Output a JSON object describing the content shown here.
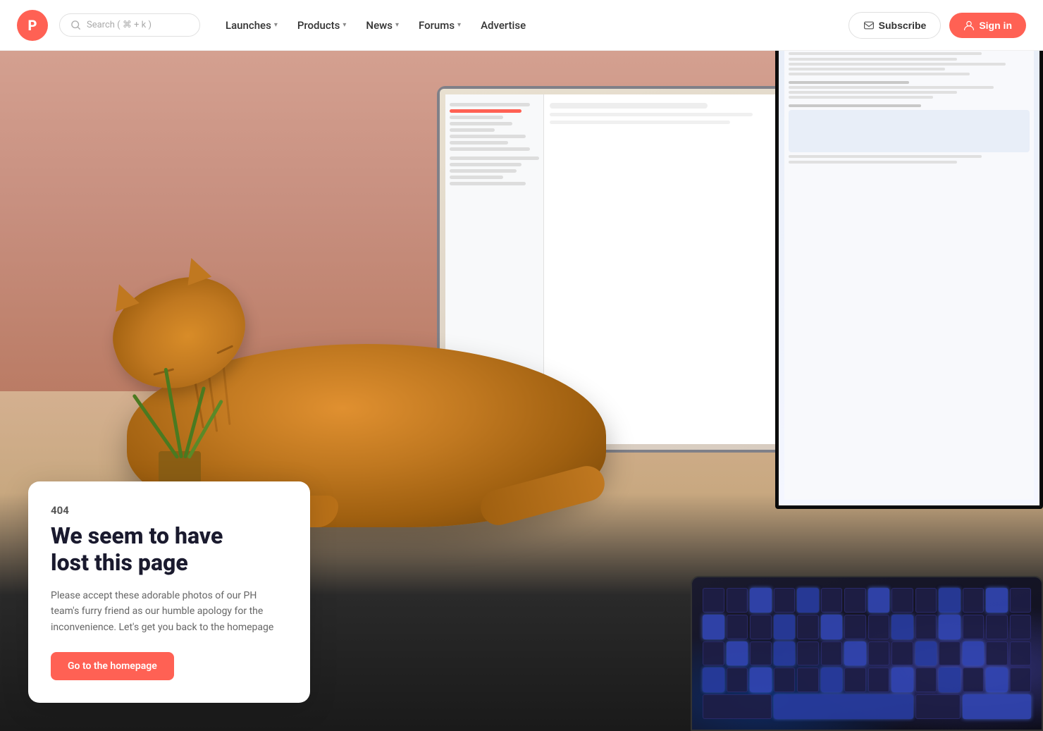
{
  "nav": {
    "logo_letter": "P",
    "search_placeholder": "Search ( ⌘ + k )",
    "links": [
      {
        "label": "Launches",
        "has_dropdown": true
      },
      {
        "label": "Products",
        "has_dropdown": true
      },
      {
        "label": "News",
        "has_dropdown": true
      },
      {
        "label": "Forums",
        "has_dropdown": true
      },
      {
        "label": "Advertise",
        "has_dropdown": false
      }
    ],
    "subscribe_label": "Subscribe",
    "signin_label": "Sign in"
  },
  "error": {
    "code": "404",
    "title_line1": "We seem to have",
    "title_line2": "lost this page",
    "description": "Please accept these adorable photos of our PH team's furry friend as our humble apology for the inconvenience. Let's get you back to the homepage",
    "cta_label": "Go to the homepage"
  }
}
